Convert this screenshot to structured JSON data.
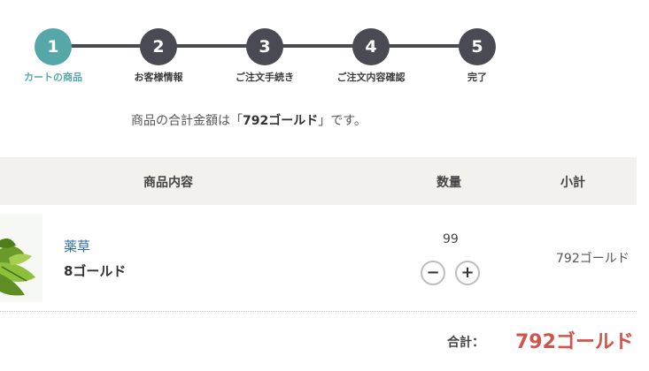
{
  "steps": [
    {
      "num": "1",
      "label": "カートの商品",
      "active": true
    },
    {
      "num": "2",
      "label": "お客様情報",
      "active": false
    },
    {
      "num": "3",
      "label": "ご注文手続き",
      "active": false
    },
    {
      "num": "4",
      "label": "ご注文内容確認",
      "active": false
    },
    {
      "num": "5",
      "label": "完了",
      "active": false
    }
  ],
  "summary": {
    "prefix": "商品の合計金額は「",
    "amount": "792ゴールド",
    "suffix": "」です。"
  },
  "table": {
    "headers": {
      "content": "商品内容",
      "quantity": "数量",
      "subtotal": "小計"
    },
    "item": {
      "name": "薬草",
      "price": "8ゴールド",
      "quantity": "99",
      "subtotal": "792ゴールド",
      "minus_icon": "minus-icon",
      "plus_icon": "plus-icon"
    }
  },
  "total": {
    "label": "合計：",
    "value": "792ゴールド"
  },
  "colors": {
    "accent": "#55a8a7",
    "step_dark": "#4a4a55",
    "price_red": "#d1534a",
    "link_blue": "#2b6cb0",
    "header_bg": "#f2f1ee"
  }
}
